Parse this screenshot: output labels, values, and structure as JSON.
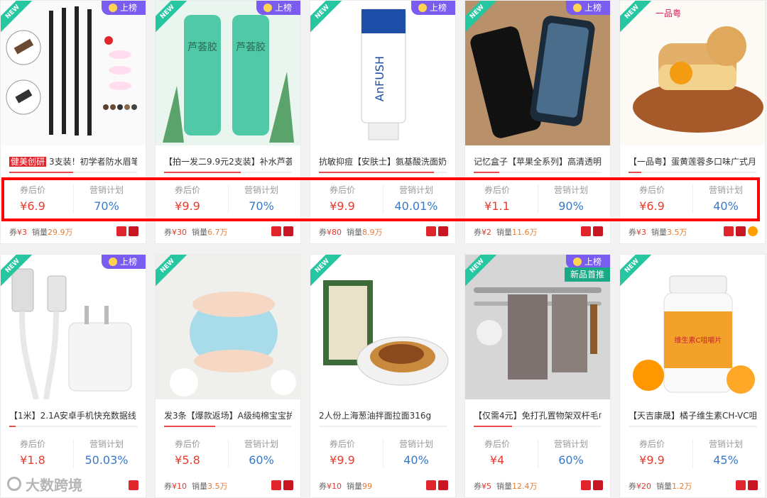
{
  "labels": {
    "price_label": "券后价",
    "plan_label": "营销计划",
    "coupon_prefix": "券",
    "sales_prefix": "销量",
    "new_badge": "NEW",
    "rank_badge": "上榜",
    "yuan": "¥"
  },
  "colors": {
    "price": "#e63b2e",
    "percent": "#3a78c4",
    "rank_badge": "#7b5cf0",
    "new_ribbon": "#26c6a1",
    "highlight_box": "#ff0000"
  },
  "products": [
    {
      "title_tag": "健美创研",
      "title": "3支装！初学者防水眉笔...",
      "price": "6.9",
      "plan": "70%",
      "coupon": "3",
      "sales": "29.9万",
      "rank": true,
      "extra_tag": "",
      "img_label": "",
      "progress": 0.5
    },
    {
      "title_tag": "",
      "title": "【拍一发二9.9元2支装】补水芦荟...",
      "price": "9.9",
      "plan": "70%",
      "coupon": "30",
      "sales": "6.7万",
      "rank": true,
      "extra_tag": "",
      "img_label": "芦荟胶",
      "progress": 0.6
    },
    {
      "title_tag": "",
      "title": "抗敏抑痘【安肤士】氨基酸洗面奶...",
      "price": "9.9",
      "plan": "40.01%",
      "coupon": "80",
      "sales": "8.9万",
      "rank": true,
      "extra_tag": "",
      "img_label": "AnFUSH",
      "progress": 0.9
    },
    {
      "title_tag": "",
      "title": "记忆盒子【苹果全系列】高清透明...",
      "price": "1.1",
      "plan": "90%",
      "coupon": "2",
      "sales": "11.6万",
      "rank": true,
      "extra_tag": "",
      "img_label": "",
      "progress": 0.2
    },
    {
      "title_tag": "",
      "title": "【一品粤】蛋黄莲蓉多口味广式月饼",
      "price": "6.9",
      "plan": "40%",
      "coupon": "3",
      "sales": "3.5万",
      "rank": false,
      "extra_tag": "",
      "img_label": "一品粤",
      "progress": 0.1
    },
    {
      "title_tag": "",
      "title": "【1米】2.1A安卓手机快充数据线",
      "price": "1.8",
      "plan": "50.03%",
      "coupon": "",
      "sales": "",
      "rank": true,
      "extra_tag": "",
      "img_label": "",
      "progress": 0.05
    },
    {
      "title_tag": "",
      "title": "发3条【爆款返场】A级纯棉宝宝护...",
      "price": "5.8",
      "plan": "60%",
      "coupon": "10",
      "sales": "3.5万",
      "rank": false,
      "extra_tag": "",
      "img_label": "",
      "progress": 0.4
    },
    {
      "title_tag": "",
      "title": "2人份上海葱油拌面拉面316g",
      "price": "9.9",
      "plan": "40%",
      "coupon": "10",
      "sales": "99",
      "rank": false,
      "extra_tag": "",
      "img_label": "",
      "progress": 0.0
    },
    {
      "title_tag": "",
      "title": "【仅需4元】免打孔置物架双杆毛巾...",
      "price": "4",
      "plan": "60%",
      "coupon": "5",
      "sales": "12.4万",
      "rank": true,
      "extra_tag": "新品首推",
      "img_label": "",
      "progress": 0.3
    },
    {
      "title_tag": "",
      "title": "【天吉康晟】橘子维生素CH-VC咀...",
      "price": "9.9",
      "plan": "45%",
      "coupon": "20",
      "sales": "1.2万",
      "rank": false,
      "extra_tag": "",
      "img_label": "维生素C咀嚼片",
      "progress": 0.0
    }
  ],
  "watermark": "大数跨境"
}
